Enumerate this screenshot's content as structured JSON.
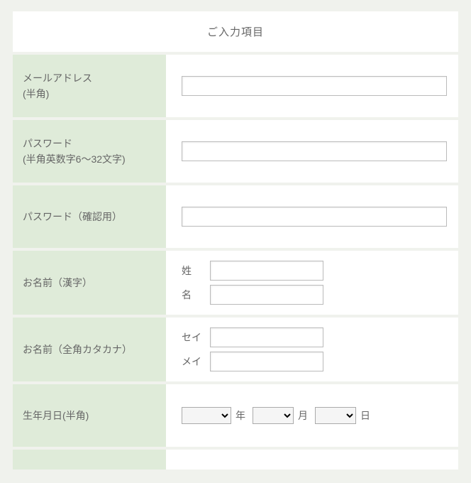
{
  "header": {
    "title": "ご入力項目"
  },
  "fields": {
    "email": {
      "label_main": "メールアドレス",
      "label_sub": "(半角)"
    },
    "password": {
      "label_main": "パスワード",
      "label_sub": "(半角英数字6～32文字)"
    },
    "password_confirm": {
      "label": "パスワード（確認用）"
    },
    "name_kanji": {
      "label": "お名前（漢字）",
      "sei_prefix": "姓",
      "mei_prefix": "名"
    },
    "name_kana": {
      "label": "お名前（全角カタカナ）",
      "sei_prefix": "セイ",
      "mei_prefix": "メイ"
    },
    "birthdate": {
      "label": "生年月日(半角)",
      "year_unit": "年",
      "month_unit": "月",
      "day_unit": "日"
    }
  }
}
